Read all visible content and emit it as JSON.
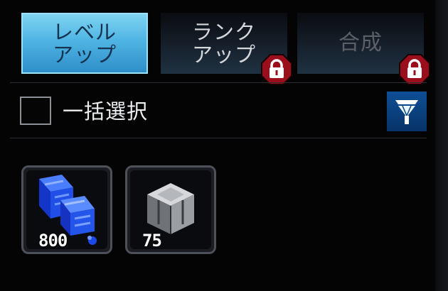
{
  "tabs": [
    {
      "label_line1": "レベル",
      "label_line2": "アップ",
      "state": "selected"
    },
    {
      "label_line1": "ランク",
      "label_line2": "アップ",
      "state": "locked"
    },
    {
      "label": "合成",
      "state": "locked"
    }
  ],
  "select_all_label": "一括選択",
  "items": [
    {
      "icon": "blue-exp-cube-stack-icon",
      "count": "800"
    },
    {
      "icon": "silver-cube-icon",
      "count": "75"
    }
  ],
  "colors": {
    "active_tab": "#4fb4e3",
    "lock_badge": "#9a0f1b",
    "filter_button": "#0a417f"
  }
}
